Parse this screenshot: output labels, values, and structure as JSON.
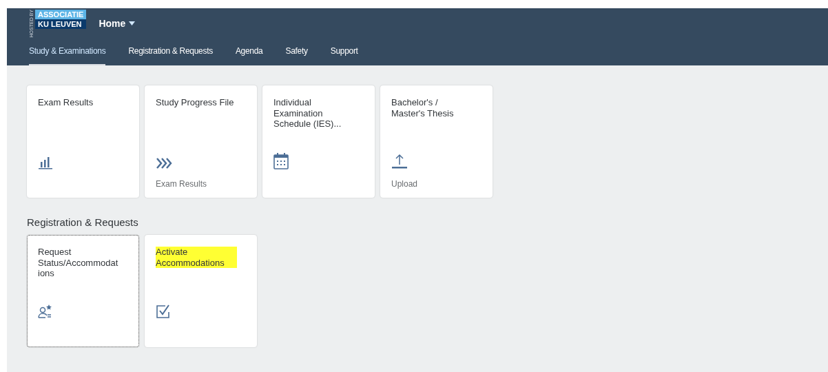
{
  "header": {
    "logo": {
      "hosted_by": "HOSTED BY",
      "line_1": "ASSOCIATIE",
      "line_2": "KU LEUVEN"
    },
    "menu_title": "Home"
  },
  "tabs": [
    {
      "label": "Study & Examinations",
      "selected": true
    },
    {
      "label": "Registration & Requests",
      "selected": false
    },
    {
      "label": "Agenda",
      "selected": false
    },
    {
      "label": "Safety",
      "selected": false
    },
    {
      "label": "Support",
      "selected": false
    }
  ],
  "groups": [
    {
      "tiles": [
        {
          "title": "Exam Results",
          "kind": "chart",
          "focused": false,
          "highlighted": false
        },
        {
          "title": "Study Progress File",
          "kind": "chevrons",
          "footer": "Exam Results",
          "focused": false,
          "highlighted": false
        },
        {
          "title": "Individual Examination Schedule (IES)...",
          "kind": "calendar",
          "focused": false,
          "highlighted": false
        },
        {
          "title": "Bachelor's / Master's Thesis",
          "kind": "upload",
          "footer": "Upload",
          "focused": false,
          "highlighted": false
        }
      ]
    },
    {
      "title": "Registration & Requests",
      "tiles": [
        {
          "title": "Request Status/Accommodat ions",
          "kind": "person",
          "focused": true,
          "highlighted": false
        },
        {
          "title": "Activate Accommodations",
          "kind": "check",
          "focused": false,
          "highlighted": true
        }
      ]
    }
  ]
}
